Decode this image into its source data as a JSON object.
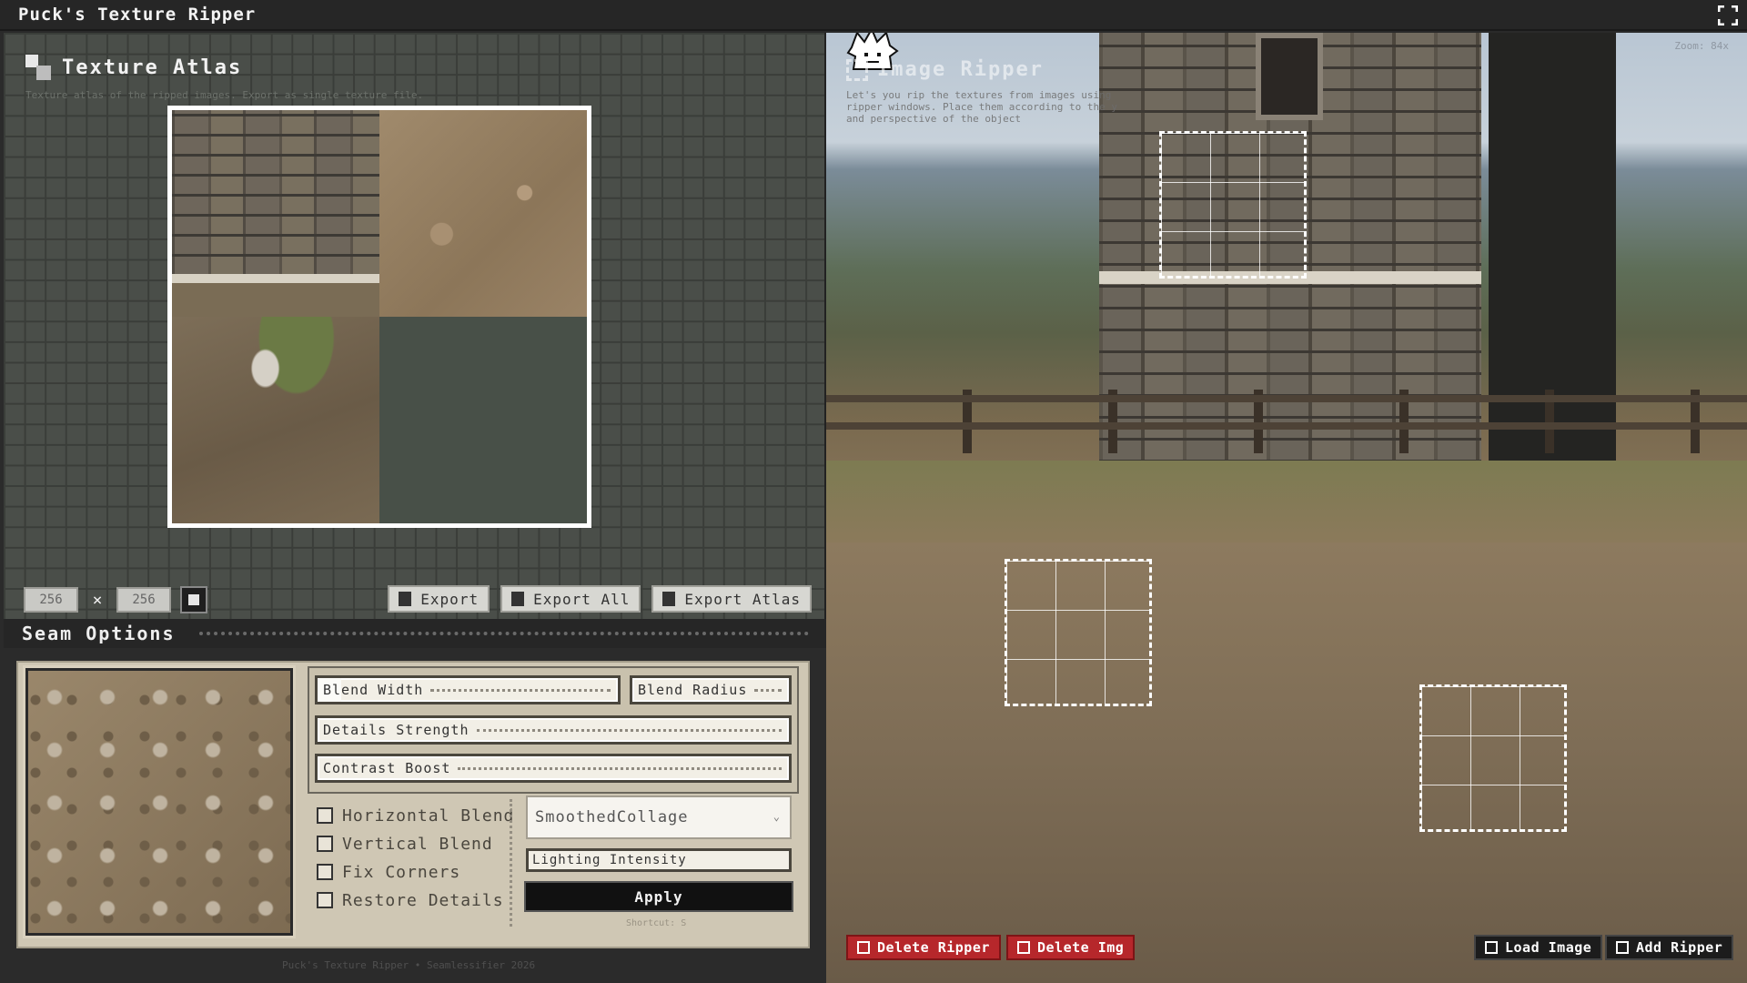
{
  "app": {
    "title": "Puck's Texture Ripper"
  },
  "atlas": {
    "title": "Texture Atlas",
    "subtitle": "Texture atlas of the ripped images. Export as single texture file.",
    "width_value": "256",
    "height_value": "256",
    "times_label": "×",
    "export_label": "Export",
    "export_all_label": "Export All",
    "export_atlas_label": "Export Atlas"
  },
  "seam": {
    "title": "Seam Options",
    "blend_width_label": "Blend Width",
    "blend_width_level": 0.08,
    "blend_radius_label": "Blend Radius",
    "details_strength_label": "Details Strength",
    "contrast_boost_label": "Contrast Boost",
    "checks": [
      {
        "label": "Horizontal Blend",
        "checked": false
      },
      {
        "label": "Vertical Blend",
        "checked": false
      },
      {
        "label": "Fix Corners",
        "checked": false
      },
      {
        "label": "Restore Details",
        "checked": false
      }
    ],
    "mode_selected": "SmoothedCollage",
    "lighting_label": "Lighting Intensity",
    "apply_label": "Apply",
    "shortcut": "Shortcut: S"
  },
  "footer": "Puck's Texture Ripper • Seamlessifier 2026",
  "ripper": {
    "title": "Image Ripper",
    "description": "Let's you rip the textures from images using ripper windows. Place them according to the y and perspective of the object",
    "zoom": "Zoom: 84x",
    "delete_ripper_label": "Delete Ripper",
    "delete_img_label": "Delete Img",
    "load_image_label": "Load Image",
    "add_ripper_label": "Add Ripper"
  },
  "colors": {
    "danger": "#b6272b",
    "panel_beige": "#cfc7b4",
    "atlas_grid": "#4a4e49",
    "dark": "#1c1c1c"
  },
  "icons": {
    "export": "export-icon",
    "export_all": "export-all-icon",
    "export_atlas": "export-atlas-icon",
    "trash": "trash-icon",
    "load": "load-image-icon",
    "add": "add-ripper-icon",
    "fullscreen": "fullscreen-icon",
    "mascot": "puck-mascot-icon"
  }
}
